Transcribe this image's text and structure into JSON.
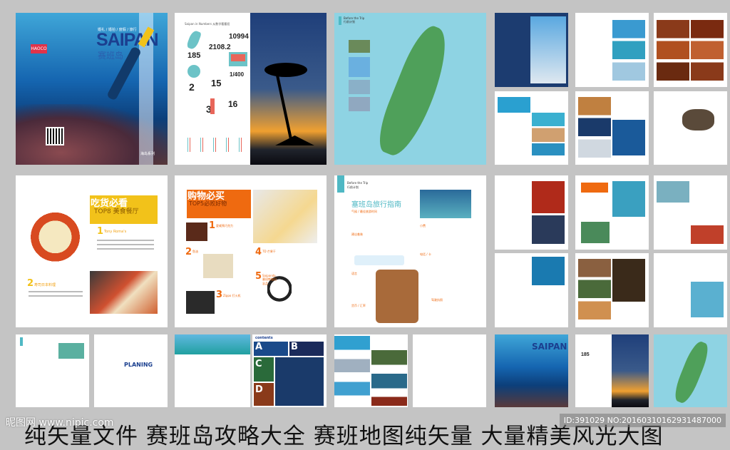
{
  "cover": {
    "title": "SAIPAN",
    "subtitle": "赛班岛",
    "tagline": "婚礼 / 婚拍 / 度假 / 旅行",
    "brand": "HAOCO",
    "series": "海岛系列"
  },
  "numbers_page": {
    "heading": "Saipan in Numbers 从数字看塞班",
    "stats": [
      "185",
      "2108.2",
      "10994",
      "2",
      "15",
      "1/400",
      "3",
      "16"
    ]
  },
  "map_page": {
    "heading": "Before the Trip",
    "subheading": "行前计划"
  },
  "food_page": {
    "title": "吃货必看",
    "subtitle": "TOP8 美食餐厅",
    "item1": "Tony Roma's",
    "item1_num": "1",
    "item2": "寿司日本料理",
    "item2_num": "2"
  },
  "shopping_page": {
    "title": "购物必买",
    "subtitle": "TOP5必败好物",
    "items": [
      {
        "num": "1",
        "label": "夏威夷巧克力"
      },
      {
        "num": "2",
        "label": "鱼油"
      },
      {
        "num": "3",
        "label": "Zippo 打火机"
      },
      {
        "num": "4",
        "label": "7D 芒果干"
      },
      {
        "num": "5",
        "label": "Saipanda 塞班熊猫纪念品"
      }
    ]
  },
  "guide_page": {
    "heading": "Before the Trip",
    "subheading": "行前计划",
    "title": "塞班岛旅行指南",
    "sections": [
      "气候 / 最佳旅游时间",
      "建议着装",
      "小费",
      "语言",
      "货币 / 汇率",
      "电话 / 卡",
      "驾驶执照"
    ]
  },
  "planning_page": {
    "logo": "PLANING"
  },
  "contents_page": {
    "title": "contents",
    "letters": [
      "A",
      "B",
      "C",
      "D"
    ]
  },
  "caption": "纯矢量文件 赛班岛攻略大全 赛班地图纯矢量 大量精美风光大图",
  "watermark": "昵图网 www.nipic.com",
  "image_id": "ID:391029 NO:20160310162931487000",
  "colors": {
    "background": "#c4c4c4",
    "teal": "#4fb8c4",
    "yellow": "#f2c21a",
    "orange": "#ef6a10",
    "coral": "#e8665a"
  }
}
